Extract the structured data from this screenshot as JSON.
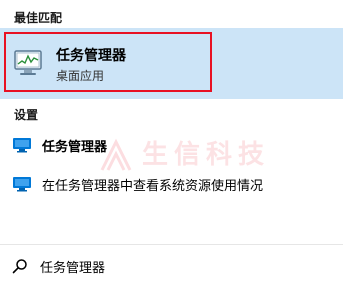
{
  "sections": {
    "best_match_header": "最佳匹配",
    "settings_header": "设置"
  },
  "best_match": {
    "title": "任务管理器",
    "subtitle": "桌面应用",
    "icon": "task-manager-icon"
  },
  "settings_results": [
    {
      "label": "任务管理器",
      "icon": "monitor-icon"
    },
    {
      "label": "在任务管理器中查看系统资源使用情况",
      "icon": "monitor-icon"
    }
  ],
  "watermark": {
    "text": "生信科技"
  },
  "search": {
    "query": "任务管理器",
    "icon": "search-icon"
  },
  "colors": {
    "selection_bg": "#cce4f7",
    "highlight_border": "#e81123",
    "accent": "#0078d7"
  }
}
